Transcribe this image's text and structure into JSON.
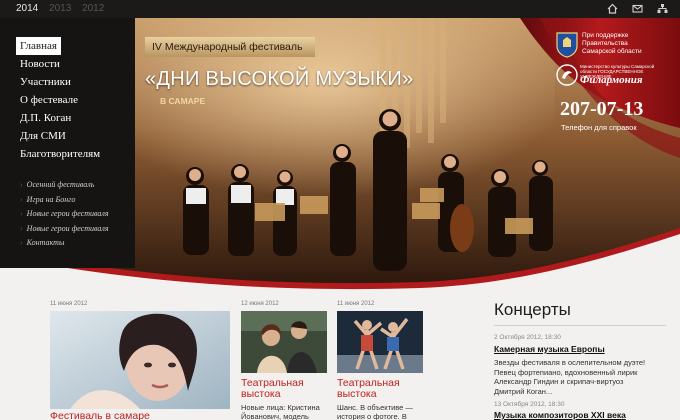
{
  "topbar": {
    "years": [
      {
        "label": "2014",
        "active": true
      },
      {
        "label": "2013",
        "active": false
      },
      {
        "label": "2012",
        "active": false
      }
    ],
    "icons": [
      "home-icon",
      "mail-icon",
      "sitemap-icon"
    ]
  },
  "nav": {
    "items": [
      "Главная",
      "Новости",
      "Участники",
      "О фестевале",
      "Д.П. Коган",
      "Для СМИ",
      "Благотворителям"
    ],
    "sub_items": [
      "Осенний фестиваль",
      "Игра на Бонго",
      "Новые герои фестиваля",
      "Новые герои фестиваля",
      "Контакты"
    ]
  },
  "hero": {
    "festival_label": "IV Международный фестиваль",
    "festival_title": "«ДНИ ВЫСОКОЙ МУЗЫКИ»",
    "festival_city": "В САМАРЕ",
    "support_text": "При поддержке Правительства Самарской области",
    "phil_small": "Министерство культуры Самарской области ГОСУДАРСТВЕННОЕ УЧРЕЖДЕНИЕ",
    "phil_name": "Филармония",
    "phone": "207-07-13",
    "phone_label": "Телефон для справок"
  },
  "news": [
    {
      "date": "11 июня 2012",
      "title": "Фестиваль в самаре",
      "text": ""
    },
    {
      "date": "12 июня 2012",
      "title": "Театральная выстока",
      "text": "Новые лица: Кристина Йованович, модель"
    },
    {
      "date": "11 июня 2012",
      "title": "Театральная выстока",
      "text": "Шанс. В объективе — история о фотоге. В"
    }
  ],
  "concerts": {
    "title": "Концерты",
    "items": [
      {
        "date": "2 Октября 2012, 18:30",
        "title": "Камерная музыка Европы",
        "desc": "Звезды фестиваля в ослепительном дуэте! Певец фортепиано, вдохновенный лирик Александр Гиндин и скрипач-виртуоз Дмитрий Коган..."
      },
      {
        "date": "13 Октября 2012, 18:30",
        "title": "Музыка композиторов XXI века",
        "desc": ""
      }
    ]
  },
  "colors": {
    "accent_red": "#c0201c",
    "dark_panel": "#161412",
    "topbar": "#1b1a19",
    "page_bg": "#f2f1ef"
  }
}
